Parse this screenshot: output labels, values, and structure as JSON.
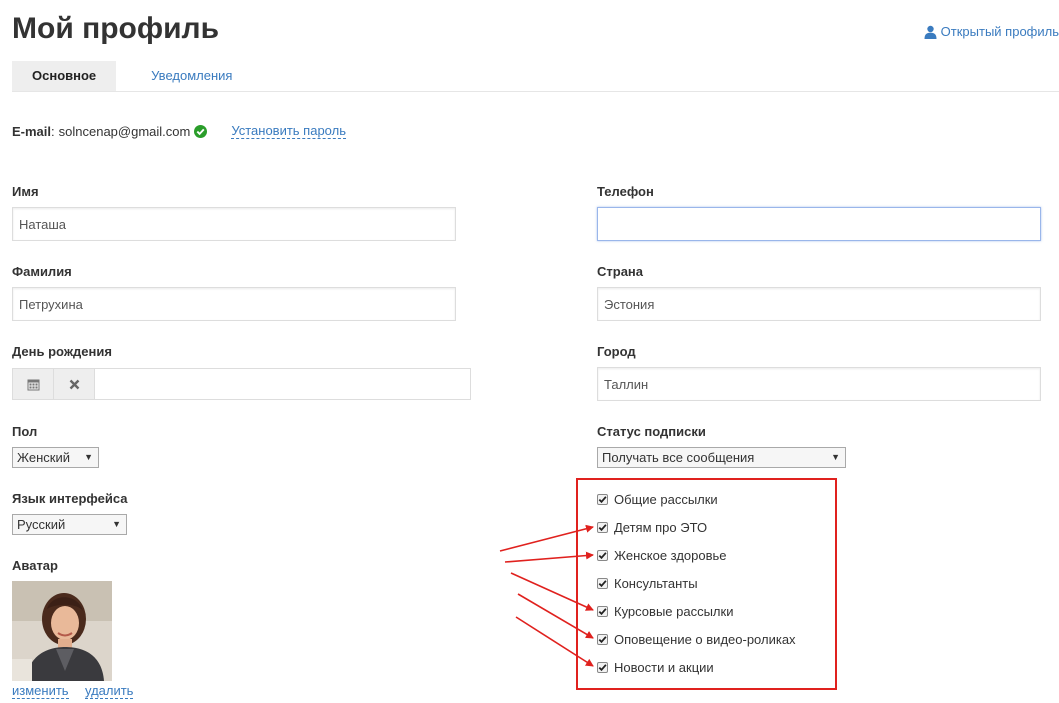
{
  "header": {
    "title": "Мой профиль",
    "open_profile_label": "Открытый профиль"
  },
  "tabs": [
    {
      "label": "Основное",
      "active": true
    },
    {
      "label": "Уведомления",
      "active": false
    }
  ],
  "account": {
    "email_label": "E-mail",
    "email_value": "solncenap@gmail.com",
    "set_password_label": "Установить пароль"
  },
  "form": {
    "first_name": {
      "label": "Имя",
      "value": "Наташа"
    },
    "last_name": {
      "label": "Фамилия",
      "value": "Петрухина"
    },
    "birthday": {
      "label": "День рождения",
      "value": ""
    },
    "gender": {
      "label": "Пол",
      "value": "Женский"
    },
    "language": {
      "label": "Язык интерфейса",
      "value": "Русский"
    },
    "avatar": {
      "label": "Аватар",
      "change_label": "изменить",
      "delete_label": "удалить"
    },
    "phone": {
      "label": "Телефон",
      "value": ""
    },
    "country": {
      "label": "Страна",
      "value": "Эстония"
    },
    "city": {
      "label": "Город",
      "value": "Таллин"
    },
    "subscription_status": {
      "label": "Статус подписки",
      "value": "Получать все сообщения"
    }
  },
  "subscriptions": [
    {
      "label": "Общие рассылки",
      "checked": true
    },
    {
      "label": "Детям про ЭТО",
      "checked": true
    },
    {
      "label": "Женское здоровье",
      "checked": true
    },
    {
      "label": "Консультанты",
      "checked": true
    },
    {
      "label": "Курсовые рассылки",
      "checked": true
    },
    {
      "label": "Оповещение о видео-роликах",
      "checked": true
    },
    {
      "label": "Новости и акции",
      "checked": true
    }
  ],
  "colors": {
    "link": "#3a7bbf",
    "annotation": "#e0211e",
    "verified": "#2a9d2a"
  }
}
